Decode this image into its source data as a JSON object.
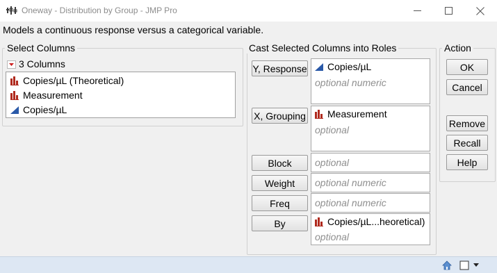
{
  "window": {
    "title": "Oneway - Distribution by Group - JMP Pro",
    "app_icon": "jmp-app-icon",
    "controls": [
      "minimize-icon",
      "maximize-icon",
      "close-icon"
    ]
  },
  "description": "Models a continuous response versus a categorical variable.",
  "select_columns": {
    "legend": "Select Columns",
    "count_label": "3 Columns",
    "columns": [
      {
        "label": "Copies/µL (Theoretical)",
        "icon": "nominal-bar-icon"
      },
      {
        "label": "Measurement",
        "icon": "nominal-bar-icon"
      },
      {
        "label": "Copies/µL",
        "icon": "continuous-triangle-icon"
      }
    ]
  },
  "roles": {
    "legend": "Cast Selected Columns into Roles",
    "y": {
      "button": "Y, Response",
      "value": "Copies/µL",
      "placeholder": "optional numeric"
    },
    "x": {
      "button": "X, Grouping",
      "value": "Measurement",
      "placeholder": "optional"
    },
    "block": {
      "button": "Block",
      "placeholder": "optional"
    },
    "weight": {
      "button": "Weight",
      "placeholder": "optional numeric"
    },
    "freq": {
      "button": "Freq",
      "placeholder": "optional numeric"
    },
    "by": {
      "button": "By",
      "value": "Copies/µL...heoretical)",
      "placeholder": "optional"
    }
  },
  "action": {
    "legend": "Action",
    "ok": "OK",
    "cancel": "Cancel",
    "remove": "Remove",
    "recall": "Recall",
    "help": "Help"
  },
  "status_bar": {
    "icons": [
      "home-icon",
      "window-square-icon",
      "dropdown-arrow-icon"
    ]
  },
  "colors": {
    "nominal_icon": "#b02a1e",
    "continuous_icon": "#2a59a8",
    "status_bar": "#dde7f3",
    "placeholder_text": "#8f8f8f"
  }
}
